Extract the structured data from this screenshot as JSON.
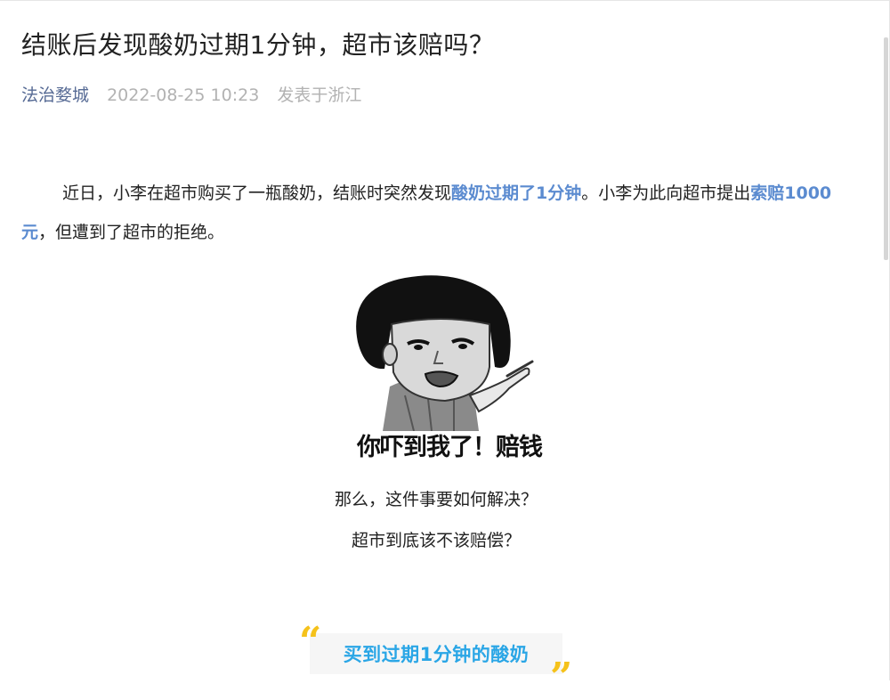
{
  "article": {
    "title": "结账后发现酸奶过期1分钟，超市该赔吗？",
    "author": "法治婺城",
    "date": "2022-08-25 10:23",
    "location": "发表于浙江"
  },
  "body": {
    "p1_part1": "近日，小李在超市购买了一瓶酸奶，结账时突然发现",
    "p1_highlight1": "酸奶过期了1分钟",
    "p1_part2": "。小李为此向超市提出",
    "p1_highlight2": "索赔1000元",
    "p1_part3": "，但遭到了超市的拒绝。",
    "meme_caption": "你吓到我了！赔钱",
    "line1": "那么，这件事要如何解决？",
    "line2": "超市到底该不该赔偿？",
    "section_title": "买到过期1分钟的酸奶",
    "quote_open": "“",
    "quote_close": "”"
  },
  "colors": {
    "author": "#576b95",
    "meta_gray": "#b2b2b2",
    "highlight_blue": "#5b8bd0",
    "section_title": "#2aa6e6",
    "quote_yellow": "#f5c21b"
  }
}
